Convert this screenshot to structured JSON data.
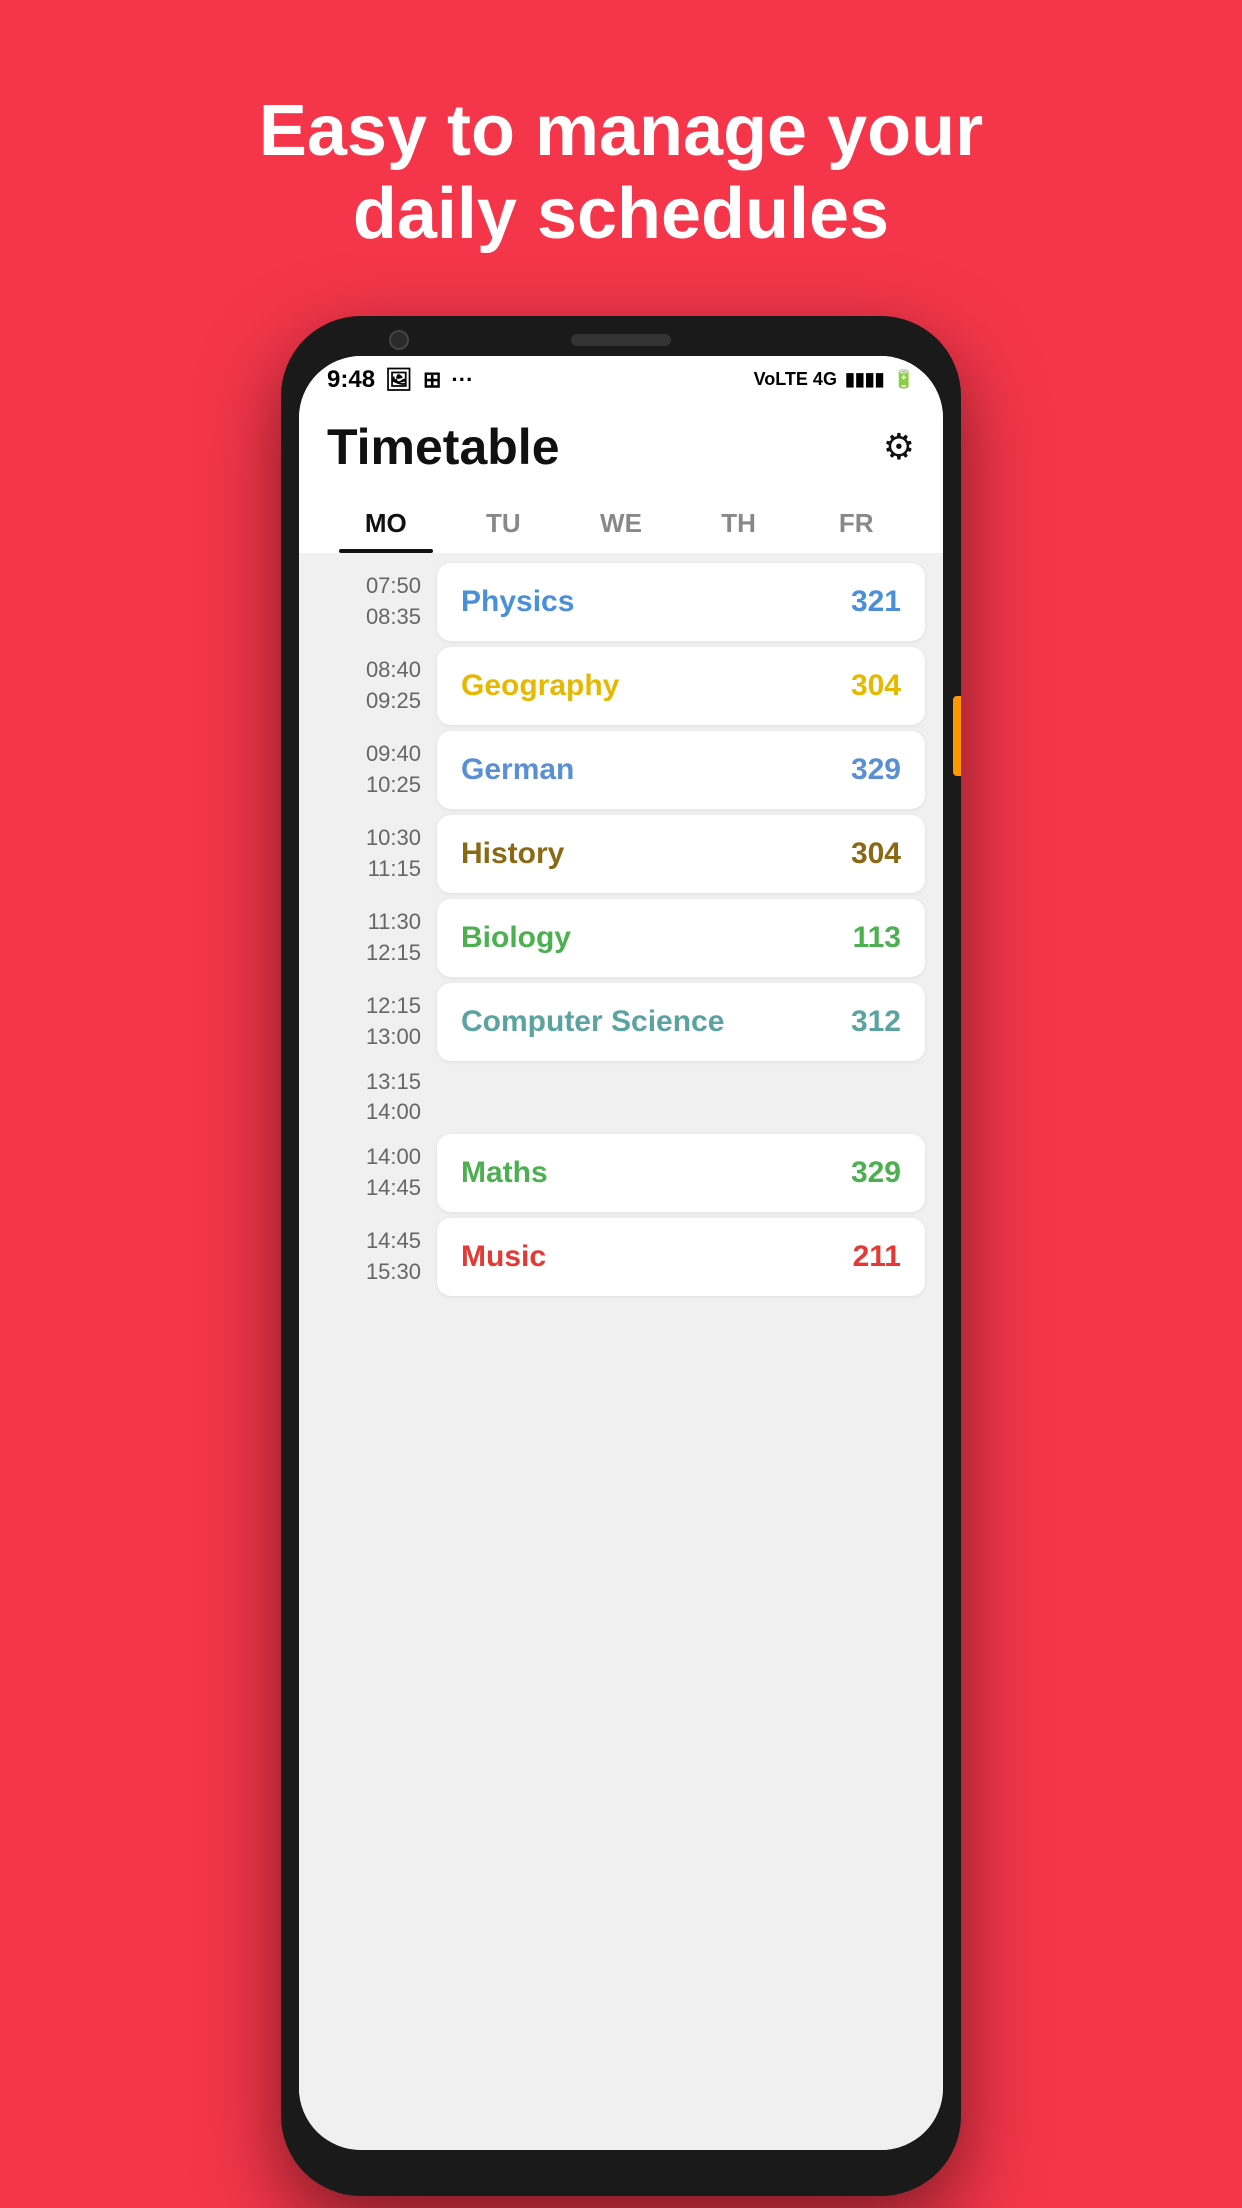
{
  "headline": {
    "line1": "Easy to manage your",
    "line2": "daily schedules"
  },
  "statusBar": {
    "time": "9:48",
    "signal": "VoLTE 4G",
    "icons": [
      "photo",
      "grid",
      "dots"
    ]
  },
  "appHeader": {
    "title": "Timetable",
    "settingsLabel": "⚙"
  },
  "days": [
    {
      "label": "MO",
      "active": true
    },
    {
      "label": "TU",
      "active": false
    },
    {
      "label": "WE",
      "active": false
    },
    {
      "label": "TH",
      "active": false
    },
    {
      "label": "FR",
      "active": false
    }
  ],
  "schedule": [
    {
      "start": "07:50",
      "end": "08:35",
      "subject": "Physics",
      "room": "321",
      "color": "color-blue",
      "empty": false
    },
    {
      "start": "08:40",
      "end": "09:25",
      "subject": "Geography",
      "room": "304",
      "color": "color-yellow",
      "empty": false
    },
    {
      "start": "09:40",
      "end": "10:25",
      "subject": "German",
      "room": "329",
      "color": "color-blue2",
      "empty": false
    },
    {
      "start": "10:30",
      "end": "11:15",
      "subject": "History",
      "room": "304",
      "color": "color-brown",
      "empty": false
    },
    {
      "start": "11:30",
      "end": "12:15",
      "subject": "Biology",
      "room": "113",
      "color": "color-green",
      "empty": false
    },
    {
      "start": "12:15",
      "end": "13:00",
      "subject": "Computer Science",
      "room": "312",
      "color": "color-teal",
      "empty": false
    },
    {
      "start": "13:15",
      "end": "14:00",
      "subject": "",
      "room": "",
      "color": "color-gray",
      "empty": true
    },
    {
      "start": "14:00",
      "end": "14:45",
      "subject": "Maths",
      "room": "329",
      "color": "color-green2",
      "empty": false
    },
    {
      "start": "14:45",
      "end": "15:30",
      "subject": "Music",
      "room": "211",
      "color": "color-red",
      "empty": false
    }
  ]
}
